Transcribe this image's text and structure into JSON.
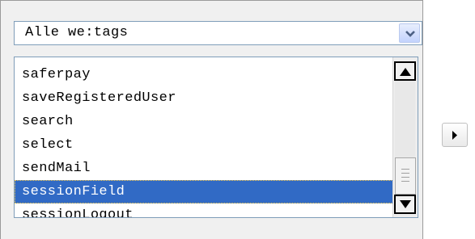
{
  "filter": {
    "selected_label": "Alle we:tags",
    "dropdown_icon": "chevron-down-icon"
  },
  "taglist": {
    "items": [
      {
        "label": "saferpay",
        "selected": false
      },
      {
        "label": "saveRegisteredUser",
        "selected": false
      },
      {
        "label": "search",
        "selected": false
      },
      {
        "label": "select",
        "selected": false
      },
      {
        "label": "sendMail",
        "selected": false
      },
      {
        "label": "sessionField",
        "selected": true
      },
      {
        "label": "sessionLogout",
        "selected": false
      }
    ],
    "selected_color": "#316ac5"
  },
  "scrollbar": {
    "up_icon": "triangle-up-icon",
    "down_icon": "triangle-down-icon"
  },
  "actions": {
    "move_icon": "triangle-right-icon"
  }
}
